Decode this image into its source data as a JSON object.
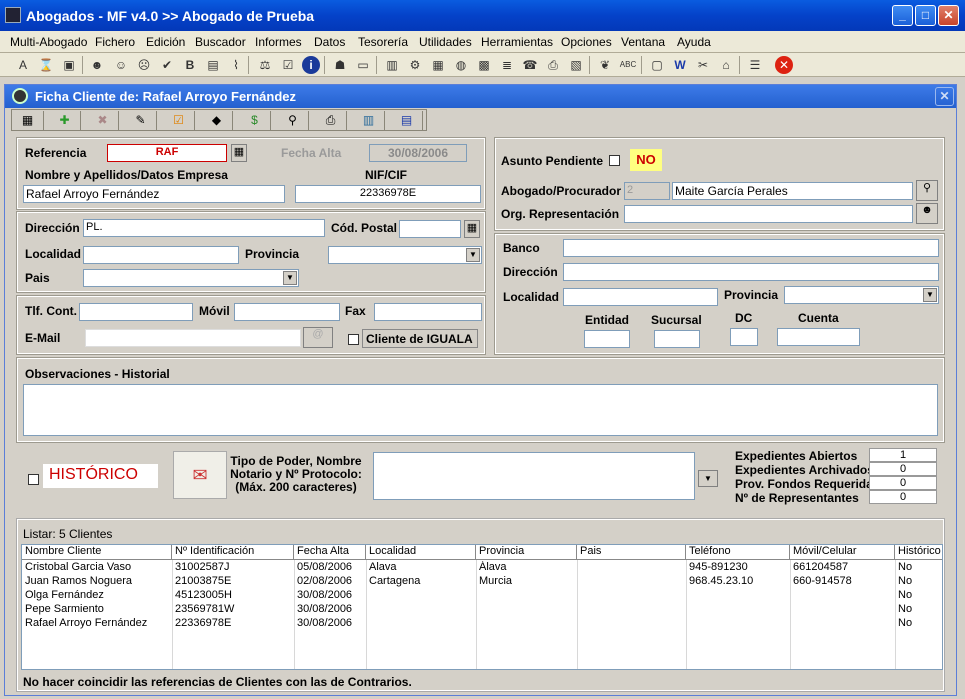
{
  "window": {
    "title": "Abogados - MF v4.0 >> Abogado de Prueba"
  },
  "menu": [
    "Multi-Abogado",
    "Fichero",
    "Edición",
    "Buscador",
    "Informes",
    "Datos",
    "Tesorería",
    "Utilidades",
    "Herramientas",
    "Opciones",
    "Ventana",
    "Ayuda"
  ],
  "child": {
    "title": "Ficha Cliente de: Rafael Arroyo Fernández"
  },
  "form": {
    "referencia_label": "Referencia",
    "referencia": "RAF",
    "fecha_alta_label": "Fecha Alta",
    "fecha_alta": "30/08/2006",
    "nombre_label": "Nombre y Apellidos/Datos Empresa",
    "nombre": "Rafael Arroyo Fernández",
    "nif_label": "NIF/CIF",
    "nif": "22336978E",
    "direccion_label": "Dirección",
    "direccion": "PL.",
    "cp_label": "Cód. Postal",
    "cp": "",
    "localidad_label": "Localidad",
    "localidad": "",
    "provincia_label": "Provincia",
    "provincia": "",
    "pais_label": "Pais",
    "pais": "",
    "tlf_label": "Tlf. Cont.",
    "movil_label": "Móvil",
    "fax_label": "Fax",
    "email_label": "E-Mail",
    "iguala_label": "Cliente de IGUALA",
    "asunto_label": "Asunto Pendiente",
    "asunto_value": "NO",
    "abogado_label": "Abogado/Procurador",
    "abogado_code": "2",
    "abogado_name": "Maite García Perales",
    "org_label": "Org. Representación",
    "banco_label": "Banco",
    "bdireccion_label": "Dirección",
    "blocalidad_label": "Localidad",
    "bprovincia_label": "Provincia",
    "entidad_label": "Entidad",
    "sucursal_label": "Sucursal",
    "dc_label": "DC",
    "cuenta_label": "Cuenta",
    "obs_label": "Observaciones - Historial",
    "historico_label": "HISTÓRICO",
    "poder_label": "Tipo de Poder, Nombre Notario y Nº Protocolo: (Máx. 200 caracteres)",
    "stats": [
      {
        "label": "Expedientes Abiertos",
        "value": "1"
      },
      {
        "label": "Expedientes Archivados",
        "value": "0"
      },
      {
        "label": "Prov. Fondos Requeridas",
        "value": "0"
      },
      {
        "label": "Nº de Representantes",
        "value": "0"
      }
    ]
  },
  "list": {
    "label": "Listar:  5 Clientes",
    "headers": [
      "Nombre Cliente",
      "Nº Identificación",
      "Fecha Alta",
      "Localidad",
      "Provincia",
      "Pais",
      "Teléfono",
      "Móvil/Celular",
      "Histórico"
    ],
    "rows": [
      [
        "Cristobal Garcia Vaso",
        "31002587J",
        "05/08/2006",
        "Alava",
        "Álava",
        "",
        "945-891230",
        "661204587",
        "No"
      ],
      [
        "Juan Ramos Noguera",
        "21003875E",
        "02/08/2006",
        "Cartagena",
        "Murcia",
        "",
        "968.45.23.10",
        "660-914578",
        "No"
      ],
      [
        "Olga Fernández",
        "45123005H",
        "30/08/2006",
        "",
        "",
        "",
        "",
        "",
        "No"
      ],
      [
        "Pepe Sarmiento",
        "23569781W",
        "30/08/2006",
        "",
        "",
        "",
        "",
        "",
        "No"
      ],
      [
        "Rafael Arroyo Fernández",
        "22336978E",
        "30/08/2006",
        "",
        "",
        "",
        "",
        "",
        "No"
      ]
    ]
  },
  "status": "No hacer coincidir las referencias de Clientes con las de Contrarios."
}
